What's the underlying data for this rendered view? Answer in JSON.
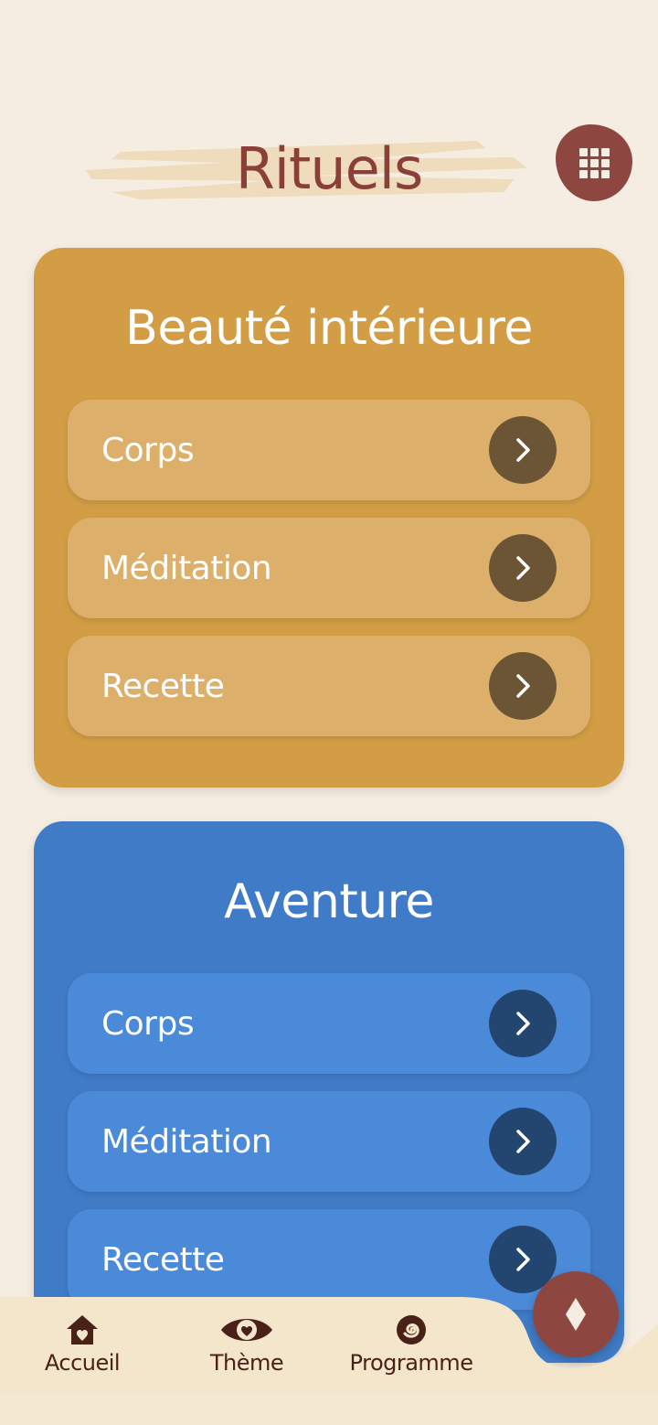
{
  "header": {
    "title": "Rituels",
    "grid_icon": "grid-icon"
  },
  "sections": [
    {
      "title": "Beauté intérieure",
      "color": "#d29d45",
      "items": [
        {
          "label": "Corps"
        },
        {
          "label": "Méditation"
        },
        {
          "label": "Recette"
        }
      ]
    },
    {
      "title": "Aventure",
      "color": "#3f7bc6",
      "items": [
        {
          "label": "Corps"
        },
        {
          "label": "Méditation"
        },
        {
          "label": "Recette"
        }
      ]
    }
  ],
  "nav": {
    "items": [
      {
        "label": "Accueil",
        "icon": "home-icon"
      },
      {
        "label": "Thème",
        "icon": "eye-icon"
      },
      {
        "label": "Programme",
        "icon": "spiral-icon"
      }
    ],
    "fab_icon": "diamond-icon"
  },
  "colors": {
    "background": "#f5ede2",
    "accent": "#8e4740"
  }
}
